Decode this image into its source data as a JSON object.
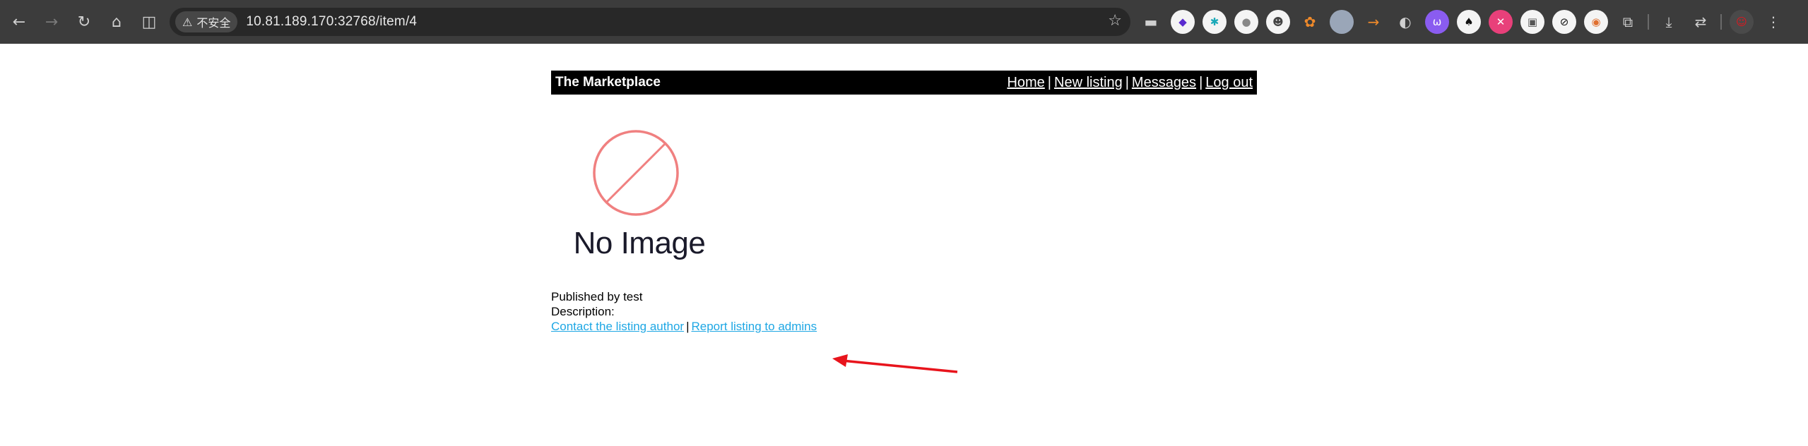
{
  "browser": {
    "url": "10.81.189.170:32768/item/4",
    "security_label": "不安全",
    "icons": {
      "back": "arrow-left-icon",
      "forward": "arrow-right-icon",
      "reload": "reload-icon",
      "home": "home-icon",
      "split": "split-view-icon",
      "bookmark": "star-icon",
      "extensions": "puzzle-icon",
      "downloads": "download-icon",
      "translate": "translate-icon",
      "menu": "kebab-menu-icon"
    }
  },
  "site": {
    "brand": "The Marketplace",
    "nav": {
      "home": "Home",
      "new_listing": "New listing",
      "messages": "Messages",
      "logout": "Log out",
      "separator": "|"
    }
  },
  "item": {
    "image_label": "No Image",
    "published_by": "Published by test",
    "description_label": "Description:",
    "contact_link": "Contact the listing author",
    "link_separator": "|",
    "report_link": "Report listing to admins"
  },
  "colors": {
    "chrome_bg": "#3c3c3c",
    "header_bg": "#000000",
    "link": "#1ea7e4",
    "noimage_stroke": "#f08080",
    "annotation_arrow": "#e8141c"
  }
}
